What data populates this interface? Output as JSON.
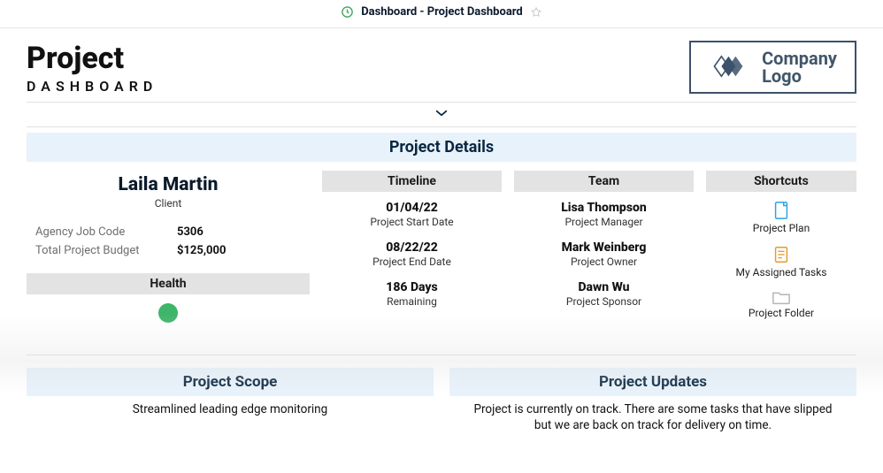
{
  "topbar": {
    "title": "Dashboard - Project Dashboard"
  },
  "header": {
    "title_line1": "Project",
    "title_line2": "DASHBOARD",
    "logo_line1": "Company",
    "logo_line2": "Logo"
  },
  "project_details": {
    "banner": "Project Details",
    "client": {
      "name": "Laila Martin",
      "role": "Client",
      "agency_job_code_label": "Agency Job Code",
      "agency_job_code_value": "5306",
      "budget_label": "Total Project Budget",
      "budget_value": "$125,000",
      "health_label": "Health",
      "health_color": "#3fb56a"
    },
    "timeline": {
      "header": "Timeline",
      "items": [
        {
          "main": "01/04/22",
          "label": "Project Start Date"
        },
        {
          "main": "08/22/22",
          "label": "Project End Date"
        },
        {
          "main": "186 Days",
          "label": "Remaining"
        }
      ]
    },
    "team": {
      "header": "Team",
      "members": [
        {
          "name": "Lisa Thompson",
          "role": "Project Manager"
        },
        {
          "name": "Mark Weinberg",
          "role": "Project Owner"
        },
        {
          "name": "Dawn Wu",
          "role": "Project Sponsor"
        }
      ]
    },
    "shortcuts": {
      "header": "Shortcuts",
      "items": [
        {
          "label": "Project Plan",
          "icon": "doc-icon"
        },
        {
          "label": "My Assigned Tasks",
          "icon": "clipboard-icon"
        },
        {
          "label": "Project Folder",
          "icon": "folder-icon"
        }
      ]
    }
  },
  "scope": {
    "banner": "Project Scope",
    "text": "Streamlined leading edge monitoring"
  },
  "updates": {
    "banner": "Project Updates",
    "text": "Project is currently on track. There are some tasks that have slipped but we are back on track for delivery on time."
  }
}
